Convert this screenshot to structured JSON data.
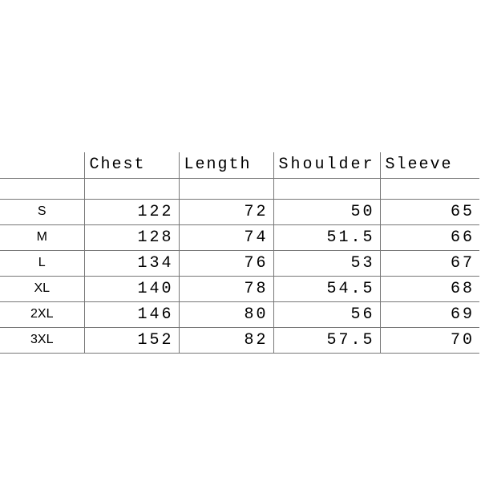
{
  "chart_data": {
    "type": "table",
    "title": "",
    "columns": [
      "",
      "Chest",
      "Length",
      "Shoulder",
      "Sleeve"
    ],
    "rows": [
      {
        "size": "S",
        "chest": 122,
        "length": 72,
        "shoulder": 50,
        "sleeve": 65
      },
      {
        "size": "M",
        "chest": 128,
        "length": 74,
        "shoulder": 51.5,
        "sleeve": 66
      },
      {
        "size": "L",
        "chest": 134,
        "length": 76,
        "shoulder": 53,
        "sleeve": 67
      },
      {
        "size": "XL",
        "chest": 140,
        "length": 78,
        "shoulder": 54.5,
        "sleeve": 68
      },
      {
        "size": "2XL",
        "chest": 146,
        "length": 80,
        "shoulder": 56,
        "sleeve": 69
      },
      {
        "size": "3XL",
        "chest": 152,
        "length": 82,
        "shoulder": 57.5,
        "sleeve": 70
      }
    ]
  }
}
